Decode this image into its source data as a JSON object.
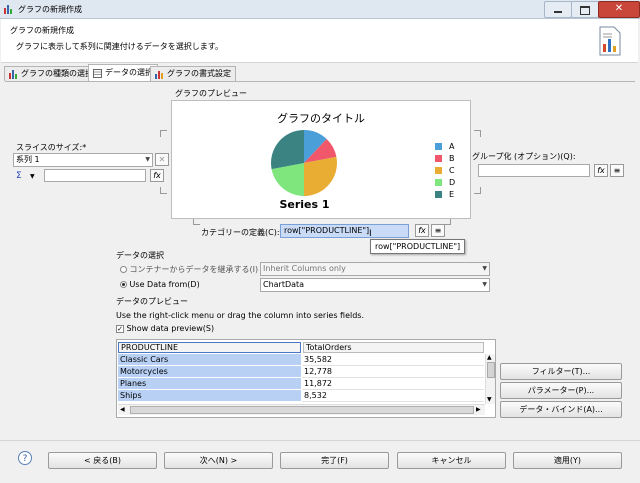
{
  "window": {
    "title": "グラフの新規作成"
  },
  "banner": {
    "heading": "グラフの新規作成",
    "description": "グラフに表示して系列に関連付けるデータを選択します。"
  },
  "tabs": [
    {
      "label": "グラフの種類の選択"
    },
    {
      "label": "データの選択"
    },
    {
      "label": "グラフの書式設定"
    }
  ],
  "preview_label": "グラフのプレビュー",
  "chart_data": {
    "type": "pie",
    "title": "グラフのタイトル",
    "series_name": "Series 1",
    "categories": [
      "A",
      "B",
      "C",
      "D",
      "E"
    ],
    "values": [
      12,
      10,
      28,
      22,
      28
    ],
    "colors": [
      "#4a9fd8",
      "#f0576b",
      "#e9ad34",
      "#7fe67e",
      "#3b8282"
    ],
    "legend_position": "right"
  },
  "slice_size": {
    "label": "スライスのサイズ:*",
    "value": "系列 1",
    "sigma": "Σ"
  },
  "group": {
    "label": "グループ化 (オプション)(Q):"
  },
  "category": {
    "label": "カテゴリーの定義(C):*",
    "value": "row[\"PRODUCTLINE\"]",
    "tooltip": "row[\"PRODUCTLINE\"]"
  },
  "data_select": {
    "label": "データの選択",
    "opt_inherit": "コンテナーからデータを継承する(I)",
    "inherit_value": "Inherit Columns only",
    "opt_use": "Use Data from(D)",
    "use_value": "ChartData"
  },
  "data_preview": {
    "label": "データのプレビュー",
    "hint": "Use the right-click menu or drag the column into series fields.",
    "show_label": "Show data preview(S)",
    "columns": [
      "PRODUCTLINE",
      "TotalOrders"
    ],
    "rows": [
      [
        "Classic Cars",
        "35,582"
      ],
      [
        "Motorcycles",
        "12,778"
      ],
      [
        "Planes",
        "11,872"
      ],
      [
        "Ships",
        "8,532"
      ]
    ]
  },
  "side_buttons": {
    "filter": "フィルター(T)...",
    "param": "パラメーター(P)...",
    "bind": "データ・バインド(A)..."
  },
  "footer": {
    "help": "?",
    "back": "< 戻る(B)",
    "next": "次へ(N) >",
    "finish": "完了(F)",
    "cancel": "キャンセル",
    "apply": "適用(Y)"
  }
}
